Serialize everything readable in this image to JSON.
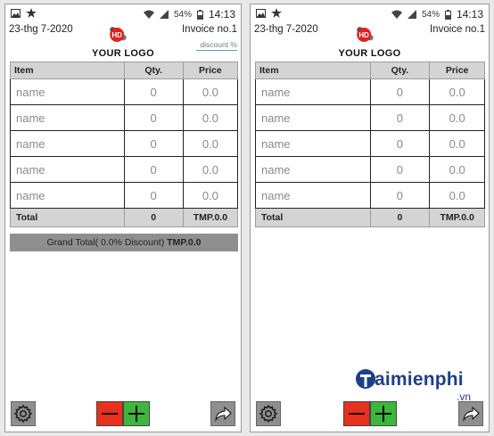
{
  "status_bar": {
    "battery": "54%",
    "time": "14:13"
  },
  "invoice": {
    "date": "23-thg 7-2020",
    "number": "Invoice no.1",
    "logo_text": "YOUR LOGO",
    "logo_badge": "HD",
    "discount_placeholder": "discount %",
    "columns": [
      "Item",
      "Qty.",
      "Price"
    ],
    "rows": [
      {
        "name": "name",
        "qty": "0",
        "price": "0.0"
      },
      {
        "name": "name",
        "qty": "0",
        "price": "0.0"
      },
      {
        "name": "name",
        "qty": "0",
        "price": "0.0"
      },
      {
        "name": "name",
        "qty": "0",
        "price": "0.0"
      },
      {
        "name": "name",
        "qty": "0",
        "price": "0.0"
      }
    ],
    "total": {
      "label": "Total",
      "qty": "0",
      "price": "TMP.0.0"
    },
    "grand_total": {
      "label": "Grand Total( 0.0% Discount)",
      "value": "TMP.0.0"
    }
  },
  "watermark": {
    "brand": "aimienphi",
    "suffix": ".vn"
  },
  "colors": {
    "minus": "#e8301e",
    "plus": "#3cb63c",
    "header_bg": "#d4d4d4",
    "grand_bg": "#8f8f8f",
    "brand": "#1e3f8a"
  }
}
